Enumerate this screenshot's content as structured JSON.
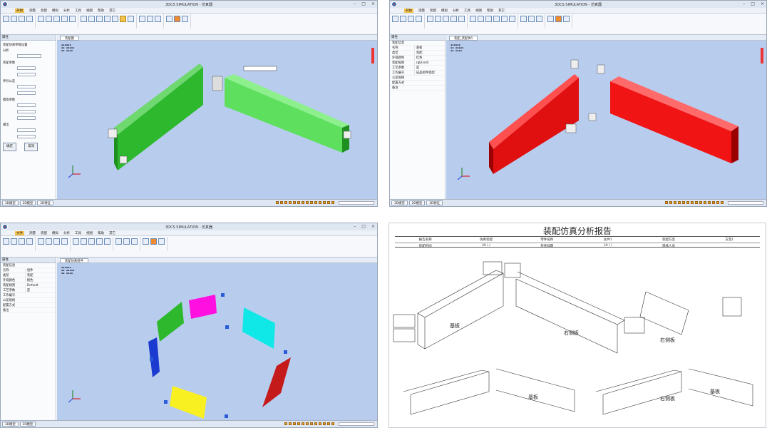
{
  "colors": {
    "viewport": "#b8cdee",
    "green": "#2db82d",
    "red": "#e01010",
    "menu_active": "#f5c34a"
  },
  "w1": {
    "title": "3DCS SIMULATION - 仿真器",
    "menu": [
      "开始",
      "测量",
      "装配",
      "模拟",
      "分析",
      "工具",
      "视图",
      "帮助",
      "其它"
    ],
    "menu_active": "开始",
    "panel_title": "属性",
    "tab": "装配图",
    "label_a": "装配仿真参数设置",
    "label_b": "分析",
    "label_c": "装配参数",
    "label_d": "传导公差",
    "label_e": "模拟参数",
    "label_f": "输出",
    "ok": "确定",
    "cancel": "取消",
    "status_tabs": [
      "3D模型",
      "2D模型",
      "3D特征"
    ]
  },
  "w2": {
    "title": "3DCS SIMULATION - 仿真器",
    "menu": [
      "开始",
      "测量",
      "装配",
      "模拟",
      "分析",
      "工具",
      "视图",
      "帮助",
      "其它"
    ],
    "menu_active": "开始",
    "panel_title": "属性",
    "tab": "装配_装配体1",
    "props": [
      [
        "装配信息",
        ""
      ],
      [
        "名称",
        "基板"
      ],
      [
        "类型",
        "装配"
      ],
      [
        "外观颜色",
        "红色"
      ],
      [
        "装配规则",
        "rgb(red)"
      ],
      [
        "工艺参数",
        "是"
      ],
      [
        "工作编号",
        "成品组件装配"
      ],
      [
        "公差规格",
        ""
      ],
      [
        "配置方式",
        ""
      ],
      [
        "备注",
        ""
      ]
    ],
    "status_tabs": [
      "3D模型",
      "2D模型",
      "3D特征"
    ]
  },
  "w3": {
    "title": "3DCS SIMULATION - 仿真器",
    "menu": [
      "文件",
      "测量",
      "装配",
      "模拟",
      "分析",
      "工具",
      "视图",
      "帮助",
      "其它"
    ],
    "menu_active": "文件",
    "panel_title": "属性",
    "tab": "装配仿真组件",
    "props": [
      [
        "装配信息",
        ""
      ],
      [
        "名称",
        "组件"
      ],
      [
        "类型",
        "装配"
      ],
      [
        "外观颜色",
        "橙色"
      ],
      [
        "装配规则",
        "Default"
      ],
      [
        "工艺参数",
        "是"
      ],
      [
        "工作编号",
        ""
      ],
      [
        "公差规格",
        ""
      ],
      [
        "配置方式",
        ""
      ],
      [
        "备注",
        ""
      ]
    ],
    "status_tabs": [
      "3D模型",
      "2D模型"
    ]
  },
  "doc": {
    "title": "装配仿真分析报告",
    "row1": [
      "报告名称",
      "仿真装配",
      "零件名称",
      "主件1",
      "装配方案",
      "方案1"
    ],
    "row2": [
      "装配时间",
      "20  /  /",
      "检查日期",
      "20  /  /",
      "审核人员",
      ""
    ],
    "labels": [
      "基板",
      "右侧板",
      "右侧板",
      "基板",
      "右侧板",
      "基板"
    ]
  }
}
